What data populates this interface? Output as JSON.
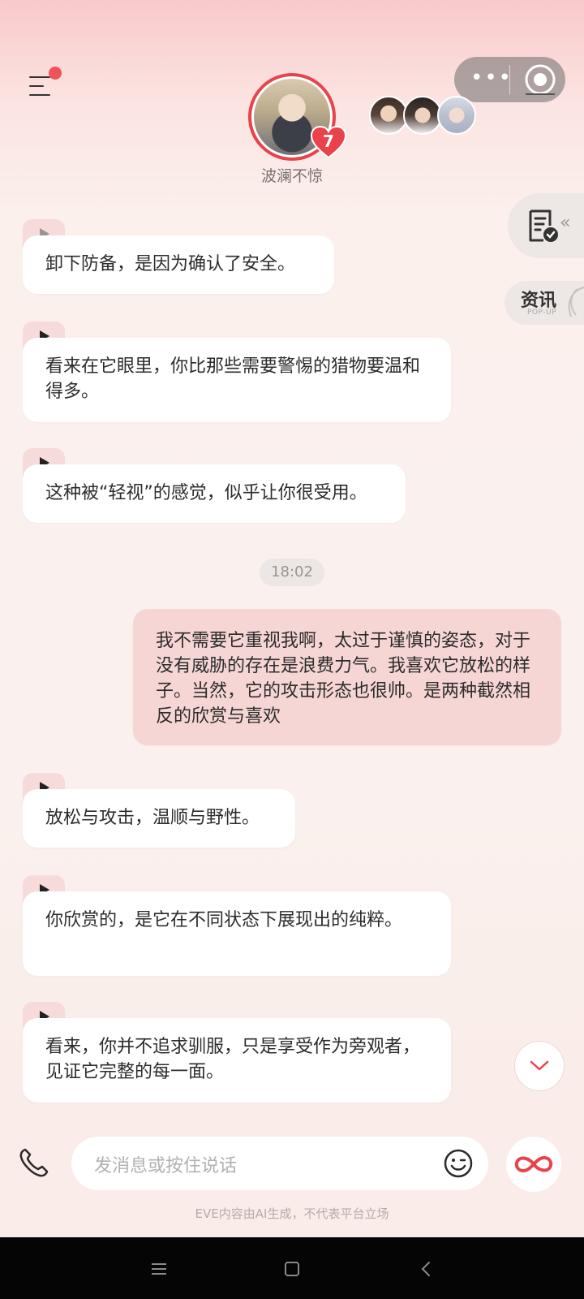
{
  "header": {
    "character_name": "波澜不惊",
    "heart_level": "7",
    "more_icon": "more-dots-icon",
    "record_icon": "record-icon"
  },
  "side": {
    "news_label": "资讯",
    "news_sub": "POP-UP"
  },
  "messages": [
    {
      "role": "ai",
      "text": "卸下防备，是因为确认了安全。"
    },
    {
      "role": "ai",
      "text": "看来在它眼里，你比那些需要警惕的猎物要温和得多。"
    },
    {
      "role": "ai",
      "text": "这种被“轻视”的感觉，似乎让你很受用。"
    },
    {
      "role": "user",
      "text": "我不需要它重视我啊，太过于谨慎的姿态，对于没有威胁的存在是浪费力气。我喜欢它放松的样子。当然，它的攻击形态也很帅。是两种截然相反的欣赏与喜欢"
    },
    {
      "role": "ai",
      "text": "放松与攻击，温顺与野性。"
    },
    {
      "role": "ai",
      "text": "你欣赏的，是它在不同状态下展现出的纯粹。"
    },
    {
      "role": "ai",
      "text": "看来，你并不追求驯服，只是享受作为旁观者，见证它完整的每一面。"
    }
  ],
  "timestamp": "18:02",
  "input": {
    "placeholder": "发消息或按住说话"
  },
  "disclaimer": "EVE内容由AI生成，不代表平台立场",
  "colors": {
    "accent": "#e9424a",
    "user_bubble": "#f5d6d4",
    "play_tab": "#f7dada"
  }
}
